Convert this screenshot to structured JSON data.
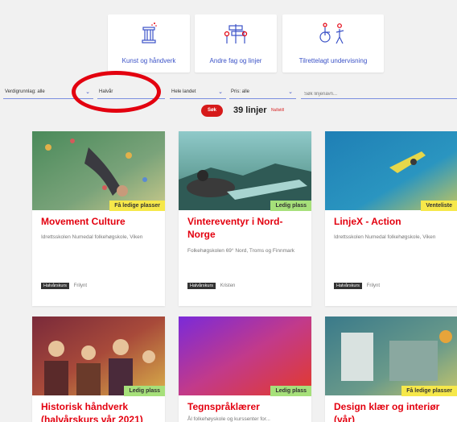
{
  "categories": [
    {
      "label": "Kunst og håndverk",
      "icon": "column-icon"
    },
    {
      "label": "Andre fag og linjer",
      "icon": "signpost-icon"
    },
    {
      "label": "Tilrettelagt undervisning",
      "icon": "accessibility-icon"
    }
  ],
  "filters": {
    "gradering": "Verdigrunnlag: alle",
    "lengde": "Halvår",
    "region": "Hele landet",
    "pris": "Pris: alle",
    "search_placeholder": "Søk linjenavn..."
  },
  "results": {
    "search_button": "Søk",
    "count": "39 linjer",
    "reset": "Nullstill"
  },
  "colors": {
    "accent_red": "#e3000f",
    "brand_blue": "#3b52c7",
    "badge_yellow": "#f6e84a",
    "badge_green": "#a6e07a"
  },
  "courses": [
    {
      "title": "Movement Culture",
      "school": "Idrettsskolen Numedal folkehøgskole, Viken",
      "badge": "Få ledige plasser",
      "badge_color": "#f6e84a",
      "tag": "Halvårskurs",
      "tag_note": "Frilynt"
    },
    {
      "title": "Vintereventyr i Nord-Norge",
      "school": "Folkehøgskolen 69° Nord, Troms og Finnmark",
      "badge": "Ledig plass",
      "badge_color": "#a6e07a",
      "tag": "Halvårskurs",
      "tag_note": "Kristen"
    },
    {
      "title": "LinjeX - Action",
      "school": "Idrettsskolen Numedal folkehøgskole, Viken",
      "badge": "Venteliste",
      "badge_color": "#f6e84a",
      "tag": "Halvårskurs",
      "tag_note": "Frilynt"
    },
    {
      "title": "Historisk håndverk (halvårskurs vår 2021)",
      "school": "",
      "badge": "Ledig plass",
      "badge_color": "#a6e07a",
      "tag": "",
      "tag_note": ""
    },
    {
      "title": "Tegnspråklærer",
      "school": "Ål folkehøyskole og kurssenter for...",
      "badge": "Ledig plass",
      "badge_color": "#a6e07a",
      "tag": "",
      "tag_note": ""
    },
    {
      "title": "Design klær og interiør (vår)",
      "school": "",
      "badge": "Få ledige plasser",
      "badge_color": "#f6e84a",
      "tag": "",
      "tag_note": ""
    }
  ]
}
